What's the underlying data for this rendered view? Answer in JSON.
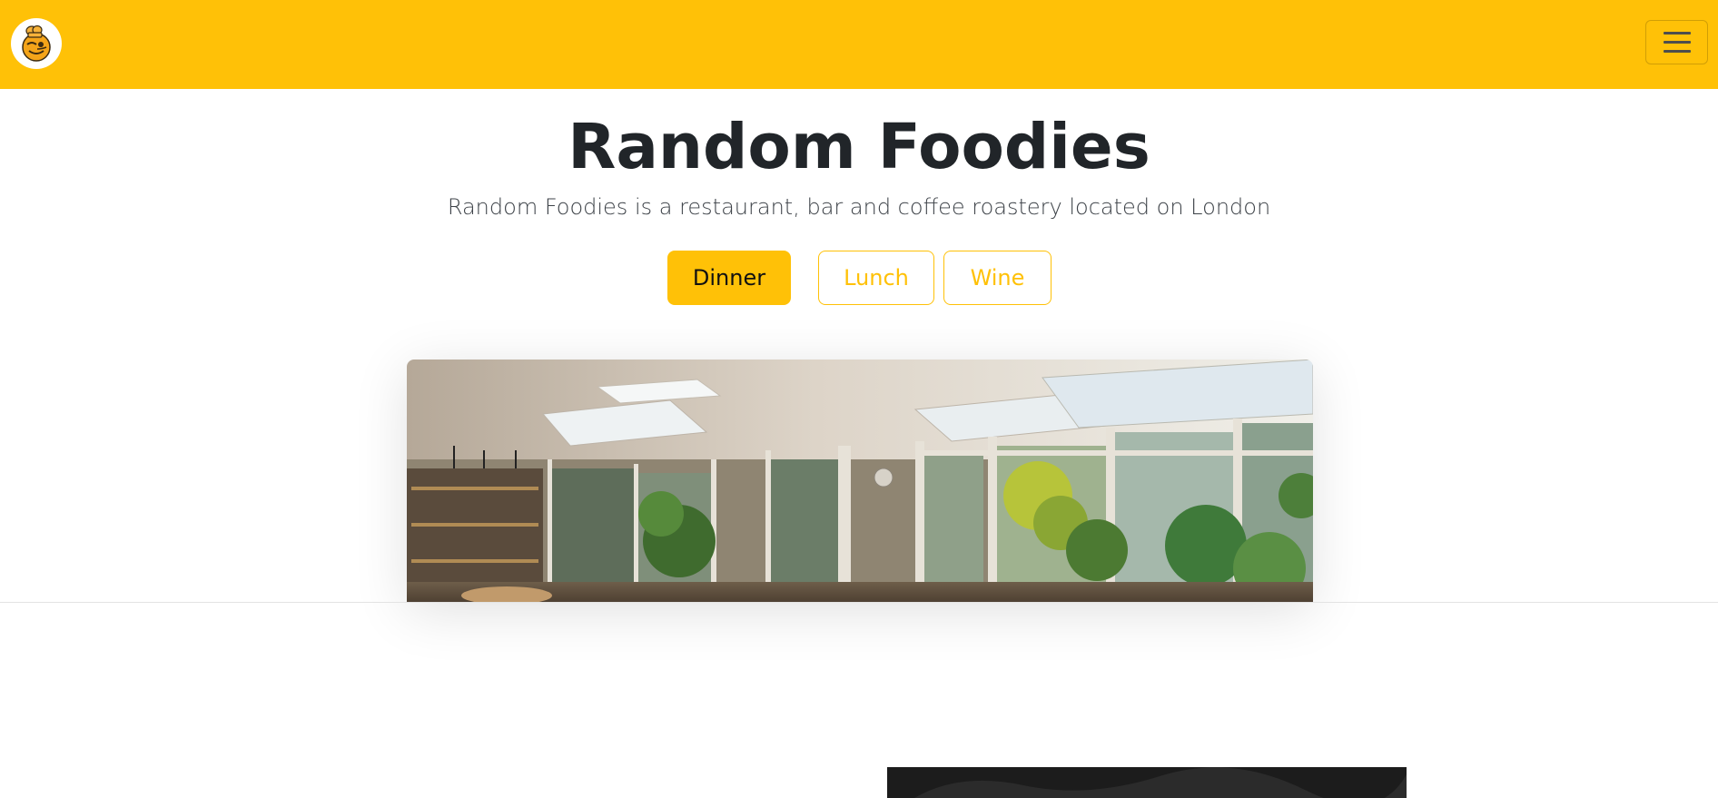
{
  "navbar": {
    "logo_icon": "chef-emoji-logo-icon",
    "menu_icon": "hamburger-menu-icon",
    "background": "#ffc107"
  },
  "hero": {
    "title": "Random Foodies",
    "lead": "Random Foodies is a restaurant, bar and coffee roastery located on London"
  },
  "menu_tabs": [
    {
      "label": "Dinner",
      "active": true
    },
    {
      "label": "Lunch",
      "active": false
    },
    {
      "label": "Wine",
      "active": false
    }
  ],
  "colors": {
    "accent": "#ffc107",
    "text": "#212529"
  },
  "images": {
    "restaurant": "restaurant-interior-photo",
    "next_section": "dark-photo"
  }
}
